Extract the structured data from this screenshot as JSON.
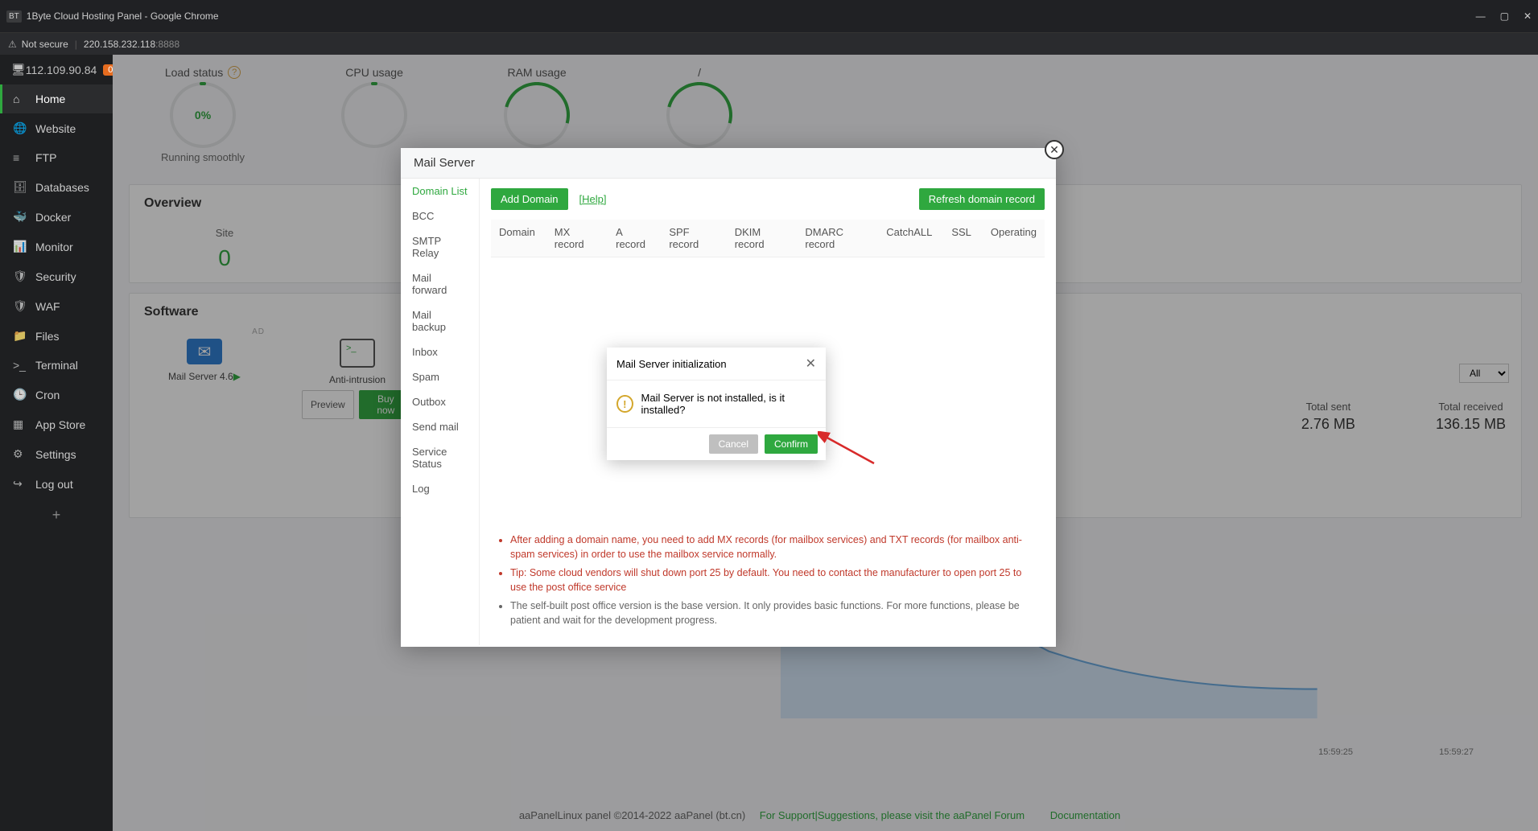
{
  "browser": {
    "title": "1Byte Cloud Hosting Panel - Google Chrome",
    "insecure": "Not secure",
    "host": "220.158.232.118",
    "port": ":8888"
  },
  "window_controls": {
    "min": "—",
    "max": "▢",
    "close": "✕"
  },
  "sidebar": {
    "ip": "112.109.90.84",
    "badge": "0",
    "items": [
      {
        "label": "Home"
      },
      {
        "label": "Website"
      },
      {
        "label": "FTP"
      },
      {
        "label": "Databases"
      },
      {
        "label": "Docker"
      },
      {
        "label": "Monitor"
      },
      {
        "label": "Security"
      },
      {
        "label": "WAF"
      },
      {
        "label": "Files"
      },
      {
        "label": "Terminal"
      },
      {
        "label": "Cron"
      },
      {
        "label": "App Store"
      },
      {
        "label": "Settings"
      },
      {
        "label": "Log out"
      }
    ],
    "plus": "+"
  },
  "gauges": {
    "load": {
      "title": "Load status",
      "value": "0%",
      "sub": "Running smoothly"
    },
    "cpu": {
      "title": "CPU usage"
    },
    "ram": {
      "title": "RAM usage"
    },
    "disk": {
      "title": "/"
    }
  },
  "overview": {
    "title": "Overview",
    "site_label": "Site",
    "site_value": "0"
  },
  "software": {
    "title": "Software",
    "ad": "AD",
    "cards": [
      {
        "name": "Mail Server 4.6",
        "play": "▶"
      },
      {
        "name": "Anti-intrusion",
        "preview": "Preview",
        "buy": "Buy now"
      }
    ]
  },
  "select_all": "All",
  "stats": [
    {
      "label": "Total sent",
      "value": "2.76 MB"
    },
    {
      "label": "Total received",
      "value": "136.15 MB"
    }
  ],
  "chart_ticks": [
    "15:59:25",
    "15:59:27"
  ],
  "footer": {
    "copy": "aaPanelLinux panel ©2014-2022 aaPanel (bt.cn)",
    "support": "For Support|Suggestions, please visit the aaPanel Forum",
    "docs": "Documentation"
  },
  "modal": {
    "title": "Mail Server",
    "side": [
      "Domain List",
      "BCC",
      "SMTP Relay",
      "Mail forward",
      "Mail backup",
      "Inbox",
      "Spam",
      "Outbox",
      "Send mail",
      "Service Status",
      "Log"
    ],
    "add_btn": "Add Domain",
    "help": "[Help]",
    "refresh": "Refresh domain record",
    "columns": [
      "Domain",
      "MX record",
      "A record",
      "SPF record",
      "DKIM record",
      "DMARC record",
      "CatchALL",
      "SSL",
      "Operating"
    ],
    "notes": [
      "After adding a domain name, you need to add MX records (for mailbox services) and TXT records (for mailbox anti-spam services) in order to use the mailbox service normally.",
      "Tip: Some cloud vendors will shut down port 25 by default. You need to contact the manufacturer to open port 25 to use the post office service",
      "The self-built post office version is the base version. It only provides basic functions. For more functions, please be patient and wait for the development progress."
    ]
  },
  "confirm": {
    "title": "Mail Server initialization",
    "msg": "Mail Server is not installed, is it installed?",
    "cancel": "Cancel",
    "ok": "Confirm"
  },
  "icons": {
    "display": "🖥",
    "home": "⌂",
    "globe": "🌐",
    "ftp": "≡",
    "db": "🗄",
    "docker": "🐳",
    "monitor": "📊",
    "shield": "🛡",
    "waf": "🛡",
    "folder": "📁",
    "terminal": ">_",
    "cron": "🕒",
    "store": "▦",
    "gear": "⚙",
    "logout": "↪",
    "mail": "✉",
    "warn": "⚠"
  }
}
